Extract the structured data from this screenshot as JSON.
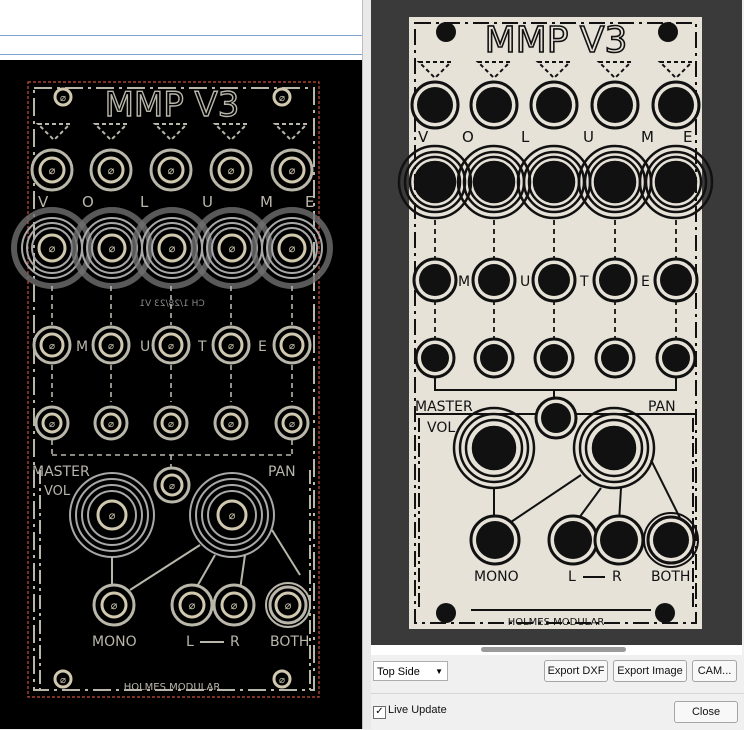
{
  "pcb_view": {
    "title": "MMP V3",
    "volume_letters": [
      "V",
      "O",
      "L",
      "U",
      "M",
      "E"
    ],
    "mute_letters": [
      "M",
      "U",
      "T",
      "E"
    ],
    "mirrored_text": "CH 1/28/23 V1",
    "master": "MASTER",
    "pan": "PAN",
    "vol": "VOL",
    "mono": "MONO",
    "l": "L",
    "r": "R",
    "both": "BOTH",
    "brand": "HOLMES MODULAR"
  },
  "panel_preview": {
    "title": "MMP V3",
    "volume_letters": [
      "V",
      "O",
      "L",
      "U",
      "M",
      "E"
    ],
    "mute_letters": [
      "M",
      "U",
      "T",
      "E"
    ],
    "master": "MASTER",
    "pan": "PAN",
    "vol": "VOL",
    "mono": "MONO",
    "l": "L",
    "r": "R",
    "both": "BOTH",
    "brand": "HOLMES MODULAR"
  },
  "toolbar": {
    "side_select": "Top Side",
    "export_dxf": "Export DXF",
    "export_image": "Export Image",
    "cam": "CAM..."
  },
  "footer": {
    "live_update_label": "Live Update",
    "live_update_checked": true,
    "close": "Close"
  },
  "colors": {
    "pcb_bg": "#000000",
    "pcb_silk": "#b9b6aa",
    "pcb_ring": "#d0c9b0",
    "panel_bg": "#e6e2d8",
    "panel_ink": "#111111",
    "preview_bg": "#3a3a3a"
  }
}
